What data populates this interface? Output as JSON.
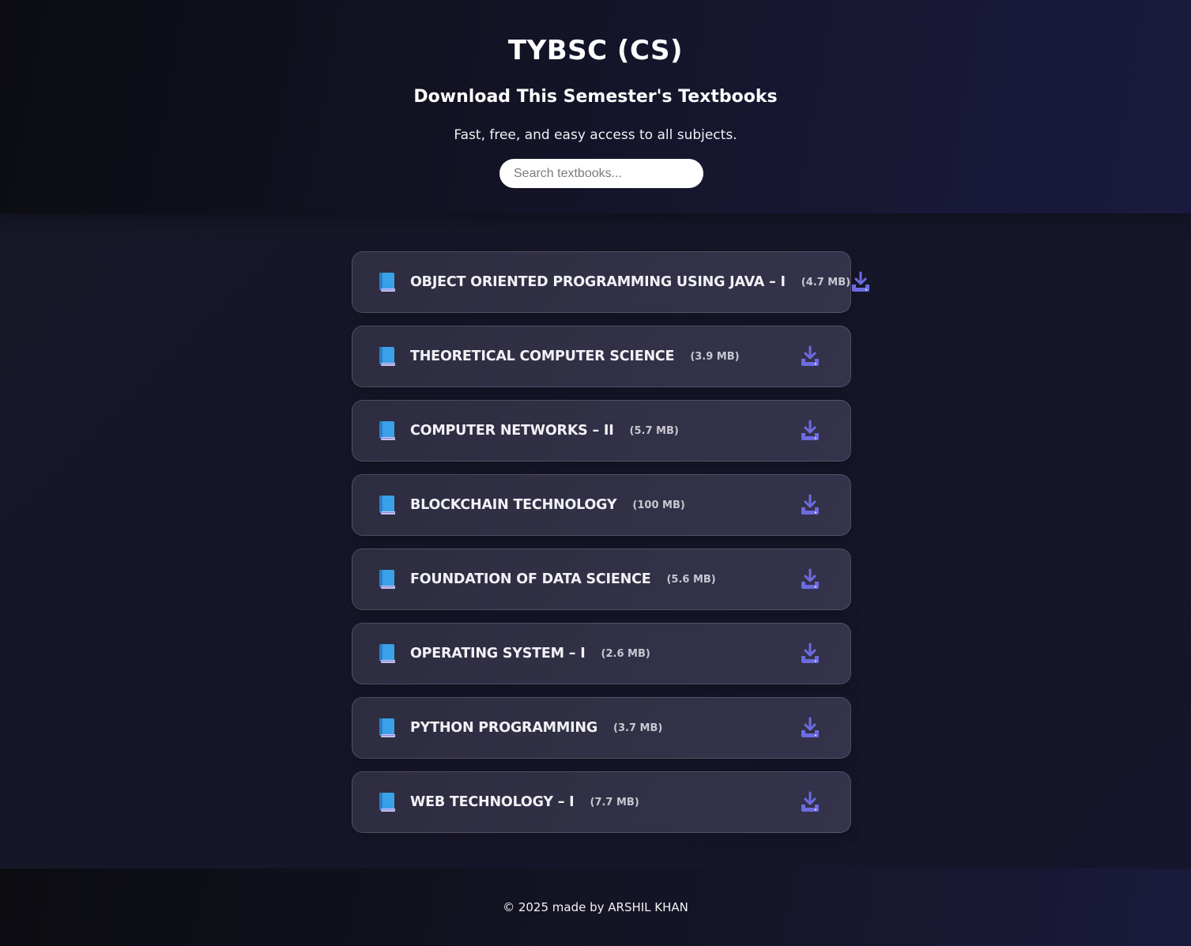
{
  "header": {
    "title": "TYBSC (CS)",
    "subtitle": "Download This Semester's Textbooks",
    "tagline": "Fast, free, and easy access to all subjects.",
    "search_placeholder": "Search textbooks..."
  },
  "books": [
    {
      "title": "OBJECT ORIENTED PROGRAMMING USING JAVA – I",
      "size": "(4.7 MB)"
    },
    {
      "title": "THEORETICAL COMPUTER SCIENCE",
      "size": "(3.9 MB)"
    },
    {
      "title": "COMPUTER NETWORKS – II",
      "size": "(5.7 MB)"
    },
    {
      "title": "BLOCKCHAIN TECHNOLOGY",
      "size": "(100 MB)"
    },
    {
      "title": "FOUNDATION OF DATA SCIENCE",
      "size": "(5.6 MB)"
    },
    {
      "title": "OPERATING SYSTEM – I",
      "size": "(2.6 MB)"
    },
    {
      "title": "PYTHON PROGRAMMING",
      "size": "(3.7 MB)"
    },
    {
      "title": "WEB TECHNOLOGY – I",
      "size": "(7.7 MB)"
    }
  ],
  "icons": {
    "book": "blue-book-icon",
    "download": "download-icon"
  },
  "colors": {
    "accent": "#6c6ce0",
    "book_blue": "#3aa0e8"
  },
  "footer": {
    "text": "© 2025 made by ARSHIL KHAN"
  }
}
